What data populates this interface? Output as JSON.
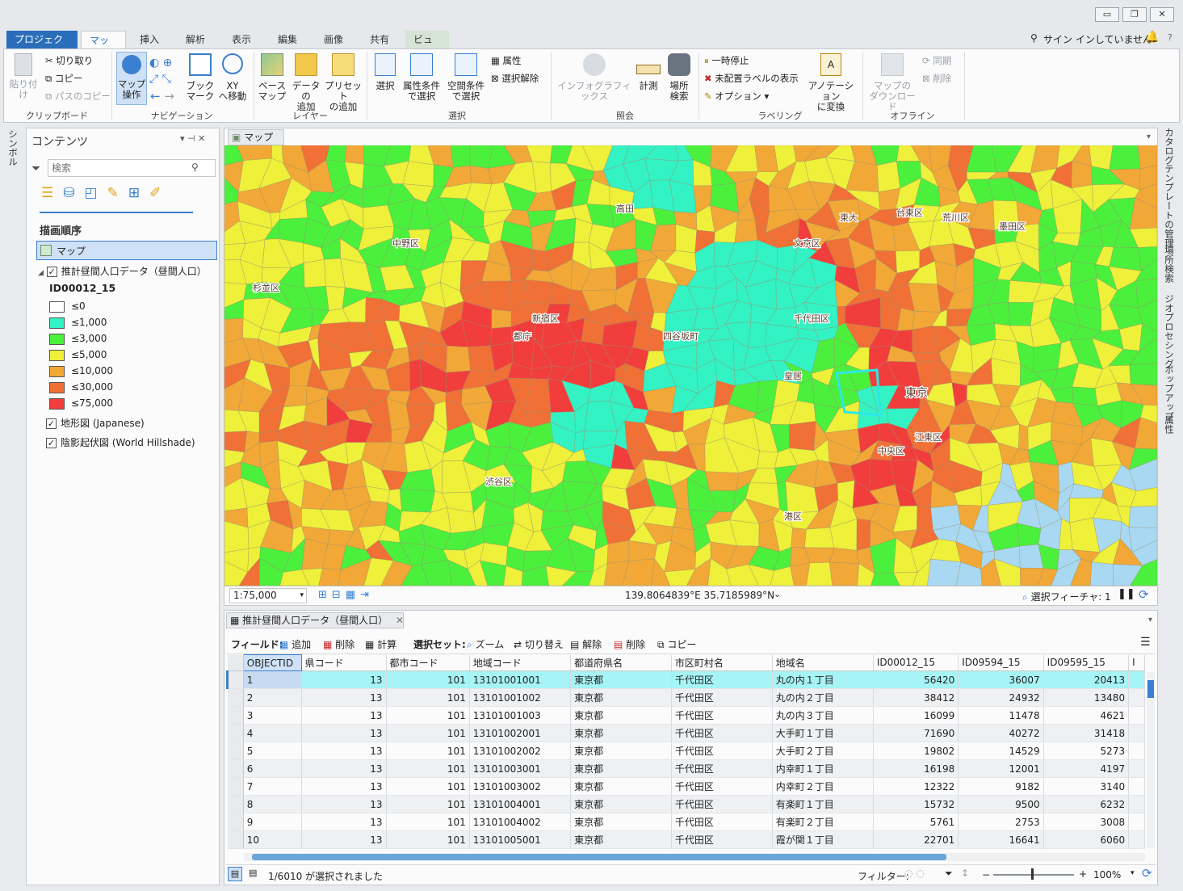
{
  "window": {
    "minimize": "▭",
    "restore": "❐",
    "close": "✕"
  },
  "tabs": [
    {
      "label": "プロジェクト"
    },
    {
      "label": "マップ"
    },
    {
      "label": "挿入"
    },
    {
      "label": "解析"
    },
    {
      "label": "表示"
    },
    {
      "label": "編集"
    },
    {
      "label": "画像"
    },
    {
      "label": "共有"
    },
    {
      "label": "ビュー"
    }
  ],
  "signin": "サイン インしていません",
  "ribbon": {
    "clipboard": {
      "label": "クリップボード",
      "paste": "貼り付け",
      "cut": "切り取り",
      "copy": "コピー",
      "copy_path": "パスのコピー"
    },
    "navigation": {
      "label": "ナビゲーション",
      "explore": "マップ\n操作",
      "bookmark": "ブック\nマーク",
      "xy": "XY\nへ移動"
    },
    "layer": {
      "label": "レイヤー",
      "basemap": "ベース\nマップ",
      "add_data": "データの\n追加",
      "preset": "プリセット\nの追加"
    },
    "selection": {
      "label": "選択",
      "select": "選択",
      "by_attr": "属性条件\nで選択",
      "by_loc": "空間条件\nで選択",
      "attributes": "属性",
      "clear": "選択解除"
    },
    "inquiry": {
      "label": "照会",
      "infographics": "インフォグラフィックス",
      "measure": "計測",
      "locate": "場所\n検索"
    },
    "labeling": {
      "label": "ラベリング",
      "pause": "一時停止",
      "unplaced": "未配置ラベルの表示",
      "options": "オプション",
      "convert": "アノテーション\nに変換"
    },
    "offline": {
      "label": "オフライン",
      "download": "マップの\nダウンロード",
      "sync": "同期",
      "remove": "削除"
    }
  },
  "left_strip": "シンボル",
  "right_strip": [
    "カタログ",
    "テンプレートの管理",
    "場所検索",
    "ジオプロセシング",
    "ポップアップ",
    "属性"
  ],
  "contents": {
    "title": "コンテンツ",
    "search_placeholder": "検索",
    "section": "描画順序",
    "map_item": "マップ",
    "layer_name": "推計昼間人口データ（昼間人口）",
    "field": "ID00012_15",
    "legend": [
      {
        "label": "≤0",
        "color": "#ffffff"
      },
      {
        "label": "≤1,000",
        "color": "#33f2c4"
      },
      {
        "label": "≤3,000",
        "color": "#4bf03c"
      },
      {
        "label": "≤5,000",
        "color": "#eef03a"
      },
      {
        "label": "≤10,000",
        "color": "#f2a836"
      },
      {
        "label": "≤30,000",
        "color": "#f07036"
      },
      {
        "label": "≤75,000",
        "color": "#f23d3d"
      }
    ],
    "basemaps": [
      {
        "label": "地形図 (Japanese)"
      },
      {
        "label": "陰影起伏図 (World Hillshade)"
      }
    ]
  },
  "map": {
    "tab": "マップ",
    "labels": [
      "中野区",
      "杉並区",
      "新宿区",
      "都庁",
      "四谷坂町",
      "千代田区",
      "文京区",
      "荒川区",
      "台東区",
      "墨田区",
      "東京",
      "中央区",
      "江東区",
      "渋谷区",
      "港区",
      "高田",
      "東大",
      "皇居"
    ],
    "scale": "1:75,000",
    "coords": "139.8064839°E 35.7185989°N",
    "selected_features": "選択フィーチャ: 1"
  },
  "table": {
    "tab": "推計昼間人口データ（昼間人口）",
    "toolbar": {
      "fields": "フィールド:",
      "add": "追加",
      "delete": "削除",
      "calculate": "計算",
      "selection_set": "選択セット:",
      "zoom": "ズーム",
      "switch": "切り替え",
      "clear": "解除",
      "delete2": "削除",
      "copy": "コピー"
    },
    "columns": [
      "OBJECTID",
      "県コード",
      "都市コード",
      "地域コード",
      "都道府県名",
      "市区町村名",
      "地域名",
      "ID00012_15",
      "ID09594_15",
      "ID09595_15"
    ],
    "rows": [
      [
        "1",
        "13",
        "101",
        "13101001001",
        "東京都",
        "千代田区",
        "丸の内１丁目",
        "56420",
        "36007",
        "20413"
      ],
      [
        "2",
        "13",
        "101",
        "13101001002",
        "東京都",
        "千代田区",
        "丸の内２丁目",
        "38412",
        "24932",
        "13480"
      ],
      [
        "3",
        "13",
        "101",
        "13101001003",
        "東京都",
        "千代田区",
        "丸の内３丁目",
        "16099",
        "11478",
        "4621"
      ],
      [
        "4",
        "13",
        "101",
        "13101002001",
        "東京都",
        "千代田区",
        "大手町１丁目",
        "71690",
        "40272",
        "31418"
      ],
      [
        "5",
        "13",
        "101",
        "13101002002",
        "東京都",
        "千代田区",
        "大手町２丁目",
        "19802",
        "14529",
        "5273"
      ],
      [
        "6",
        "13",
        "101",
        "13101003001",
        "東京都",
        "千代田区",
        "内幸町１丁目",
        "16198",
        "12001",
        "4197"
      ],
      [
        "7",
        "13",
        "101",
        "13101003002",
        "東京都",
        "千代田区",
        "内幸町２丁目",
        "12322",
        "9182",
        "3140"
      ],
      [
        "8",
        "13",
        "101",
        "13101004001",
        "東京都",
        "千代田区",
        "有楽町１丁目",
        "15732",
        "9500",
        "6232"
      ],
      [
        "9",
        "13",
        "101",
        "13101004002",
        "東京都",
        "千代田区",
        "有楽町２丁目",
        "5761",
        "2753",
        "3008"
      ],
      [
        "10",
        "13",
        "101",
        "13101005001",
        "東京都",
        "千代田区",
        "霞が関１丁目",
        "22701",
        "16641",
        "6060"
      ]
    ],
    "status": "1/6010 が選択されました",
    "filter": "フィルター:",
    "zoom": "100%"
  }
}
